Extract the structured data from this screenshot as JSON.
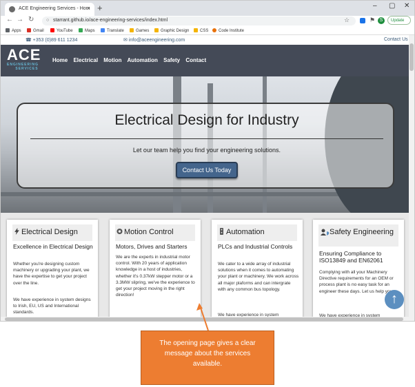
{
  "browser": {
    "tab_title": "ACE Engineering Services - Hom",
    "tab_close": "×",
    "new_tab": "+",
    "window_controls": [
      "–",
      "▢",
      "✕"
    ],
    "url": "starrant.github.io/ace-engineering-services/index.html",
    "avatar_letter": "S",
    "update_label": "Update",
    "bookmarks": [
      {
        "label": "Apps",
        "color": "#5f6368"
      },
      {
        "label": "Gmail",
        "color": "#d93025"
      },
      {
        "label": "YouTube",
        "color": "#ff0000"
      },
      {
        "label": "Maps",
        "color": "#34a853"
      },
      {
        "label": "Translate",
        "color": "#4285f4"
      },
      {
        "label": "Games",
        "color": "#f4b400"
      },
      {
        "label": "Graphic Design",
        "color": "#f4b400"
      },
      {
        "label": "CSS",
        "color": "#f4b400"
      },
      {
        "label": "Code Institute",
        "color": "#e8710a"
      }
    ]
  },
  "site": {
    "phone": "+353 (0)89 611 1234",
    "email": "info@aceengineering.com",
    "contact_link": "Contact Us",
    "logo_main": "ACE",
    "logo_sub_1": "ENGINEERING",
    "logo_sub_2": "SERVICES",
    "nav": [
      "Home",
      "Electrical",
      "Motion",
      "Automation",
      "Safety",
      "Contact"
    ],
    "hero": {
      "title": "Electrical Design for Industry",
      "subtitle": "Let our team help you find your engineering solutions.",
      "button": "Contact Us Today"
    },
    "cards": [
      {
        "title": "Electrical Design",
        "icon": "bolt-icon",
        "subtitle": "Excellence in Electrical Design",
        "body1": "Whether you're designing custom machinery or upgrading your plant, we have the expertise to get your project over the line.",
        "body2": "We have experience in system designs to Irish, EU, US and International standards."
      },
      {
        "title": "Motion Control",
        "icon": "motion-icon",
        "subtitle": "Motors, Drives and Starters",
        "body1": "We are the experts in industrial motor control. With 20 years of application knowledge in a host of industries, whether it's 0.37kW stepper motor or a 3.3MW slipring, we've the experience to get your project moving in the right direction!",
        "body2": ""
      },
      {
        "title": "Automation",
        "icon": "automation-icon",
        "subtitle": "PLCs and Industrial Controls",
        "body1": "We cater to a wide array of industrial solutions when it comes to automating your plant or machinery. We work across all major plaforms and can intergrate with any common bus topology.",
        "body2": "We have experience in system"
      },
      {
        "title": "Safety Engineering",
        "icon": "safety-icon",
        "subtitle": "Ensuring Compliance to ISO13849 and EN62061",
        "body1": "Complying with all your Machinery Directive requirements for an OEM or process plant is no easy task for an engineer these days. Let us help you",
        "body2": "We have experience in system"
      }
    ],
    "scroll_top": "↑"
  },
  "annotation": {
    "text": "The opening page gives a clear message about the services available.",
    "color": "#ed7d31"
  }
}
